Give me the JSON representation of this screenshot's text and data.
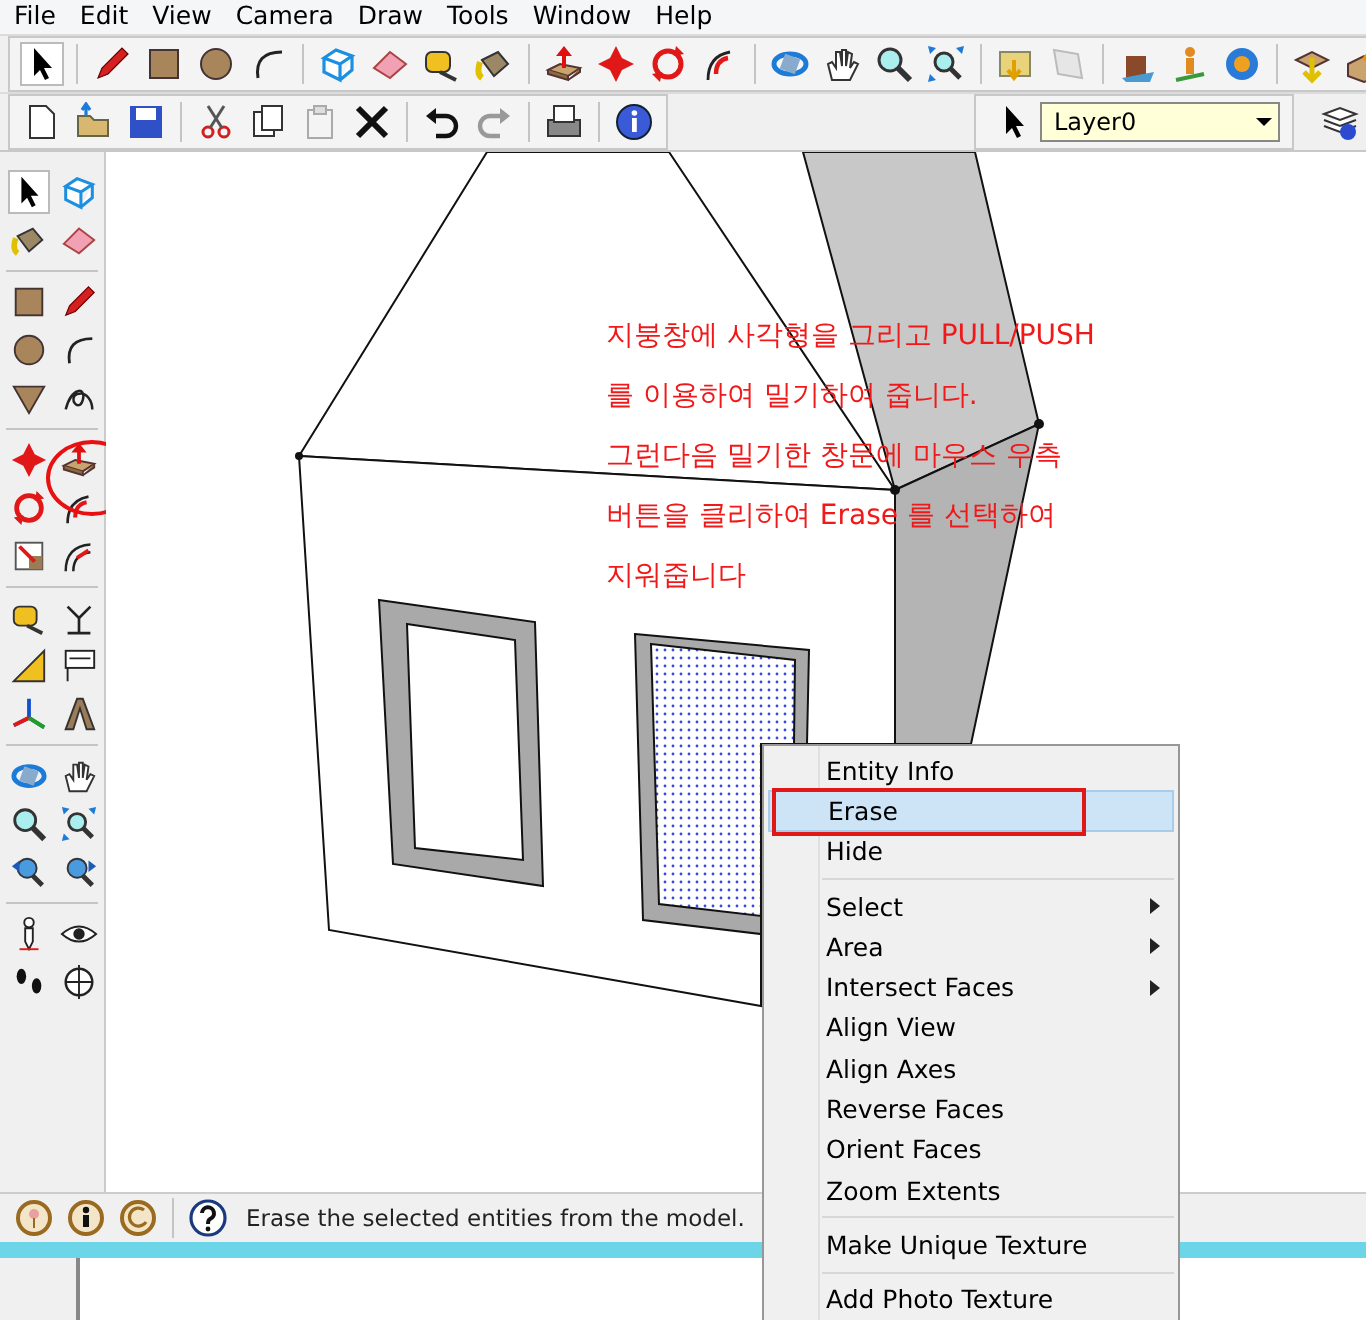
{
  "menu_bar": [
    "File",
    "Edit",
    "View",
    "Camera",
    "Draw",
    "Tools",
    "Window",
    "Help"
  ],
  "layer_dropdown": {
    "value": "Layer0"
  },
  "annotation": {
    "lines": [
      "지붕창에 사각형을 그리고 PULL/PUSH",
      "를 이용하여 밀기하여 줍니다.",
      "그런다음 밀기한 창문에 마우스 우측",
      "버튼을 클리하여 Erase 를 선택하여",
      "지워줍니다"
    ]
  },
  "context_menu": {
    "sections": [
      [
        {
          "label": "Entity Info",
          "selected": false,
          "submenu": false,
          "boxed": false
        },
        {
          "label": "Erase",
          "selected": true,
          "submenu": false,
          "boxed": true
        },
        {
          "label": "Hide",
          "selected": false,
          "submenu": false,
          "boxed": false
        }
      ],
      [
        {
          "label": "Select",
          "selected": false,
          "submenu": true,
          "boxed": false
        },
        {
          "label": "Area",
          "selected": false,
          "submenu": true,
          "boxed": false
        },
        {
          "label": "Intersect Faces",
          "selected": false,
          "submenu": true,
          "boxed": false
        },
        {
          "label": "Align View",
          "selected": false,
          "submenu": false,
          "boxed": false
        },
        {
          "label": "Align Axes",
          "selected": false,
          "submenu": false,
          "boxed": false
        },
        {
          "label": "Reverse Faces",
          "selected": false,
          "submenu": false,
          "boxed": false
        },
        {
          "label": "Orient Faces",
          "selected": false,
          "submenu": false,
          "boxed": false
        },
        {
          "label": "Zoom Extents",
          "selected": false,
          "submenu": false,
          "boxed": false
        }
      ],
      [
        {
          "label": "Make Unique Texture",
          "selected": false,
          "submenu": false,
          "boxed": false
        }
      ],
      [
        {
          "label": "Add Photo Texture",
          "selected": false,
          "submenu": false,
          "boxed": false
        }
      ]
    ]
  },
  "status_bar": {
    "message": "Erase the selected entities from the model."
  }
}
